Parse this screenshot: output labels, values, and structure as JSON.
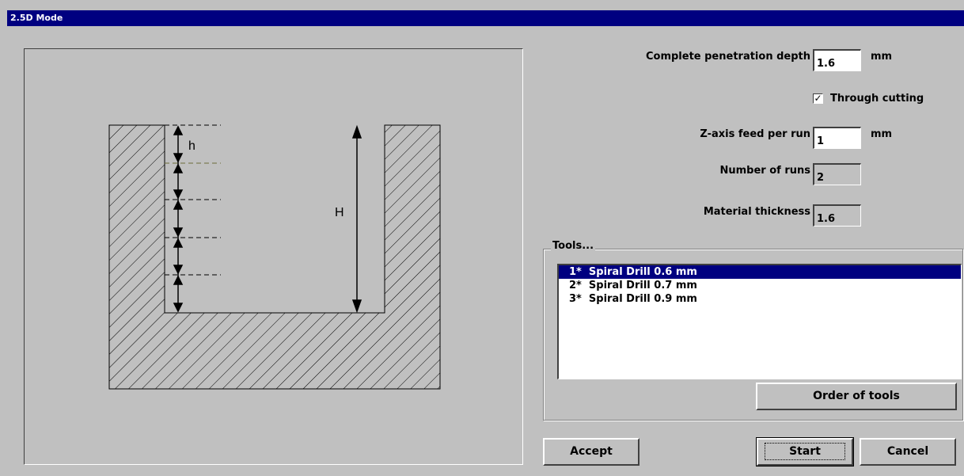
{
  "window": {
    "title": "2.5D Mode"
  },
  "diagram": {
    "label_small": "h",
    "label_large": "H"
  },
  "form": {
    "penetration_label": "Complete penetration depth",
    "penetration_value": "1.6",
    "penetration_unit": "mm",
    "through_cutting_label": "Through cutting",
    "through_cutting_checked": true,
    "zfeed_label": "Z-axis feed per run",
    "zfeed_value": "1",
    "zfeed_unit": "mm",
    "runs_label": "Number of runs",
    "runs_value": "2",
    "thickness_label": "Material thickness",
    "thickness_value": "1.6"
  },
  "tools": {
    "group_label": "Tools...",
    "items": [
      {
        "label": "1*  Spiral Drill 0.6 mm",
        "selected": true
      },
      {
        "label": "2*  Spiral Drill 0.7 mm",
        "selected": false
      },
      {
        "label": "3*  Spiral Drill 0.9 mm",
        "selected": false
      }
    ],
    "order_button": "Order of tools"
  },
  "buttons": {
    "accept": "Accept",
    "start": "Start",
    "cancel": "Cancel"
  }
}
